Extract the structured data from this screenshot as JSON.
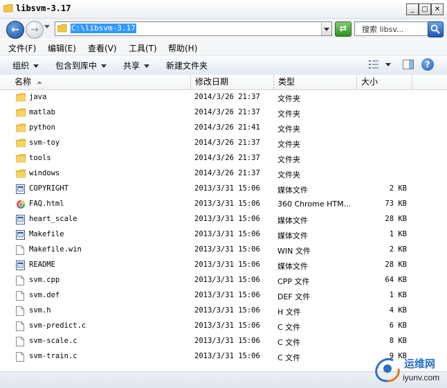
{
  "window": {
    "title": "libsvm-3.17"
  },
  "address_bar": {
    "path": "C:\\libsvm-3.17"
  },
  "search": {
    "placeholder": "搜索 libsv..."
  },
  "menu": [
    "文件(F)",
    "编辑(E)",
    "查看(V)",
    "工具(T)",
    "帮助(H)"
  ],
  "toolbar": {
    "organize": "组织",
    "include_in_library": "包含到库中",
    "share": "共享",
    "new_folder": "新建文件夹"
  },
  "columns": {
    "name": "名称",
    "date": "修改日期",
    "type": "类型",
    "size": "大小"
  },
  "files": [
    {
      "name": "java",
      "date": "2014/3/26 21:37",
      "type": "文件夹",
      "size": "",
      "icon": "folder-icon"
    },
    {
      "name": "matlab",
      "date": "2014/3/26 21:37",
      "type": "文件夹",
      "size": "",
      "icon": "folder-icon"
    },
    {
      "name": "python",
      "date": "2014/3/26 21:41",
      "type": "文件夹",
      "size": "",
      "icon": "folder-icon"
    },
    {
      "name": "svm-toy",
      "date": "2014/3/26 21:37",
      "type": "文件夹",
      "size": "",
      "icon": "folder-icon"
    },
    {
      "name": "tools",
      "date": "2014/3/26 21:37",
      "type": "文件夹",
      "size": "",
      "icon": "folder-icon"
    },
    {
      "name": "windows",
      "date": "2014/3/26 21:37",
      "type": "文件夹",
      "size": "",
      "icon": "folder-icon"
    },
    {
      "name": "COPYRIGHT",
      "date": "2013/3/31 15:06",
      "type": "媒体文件",
      "size": "2 KB",
      "icon": "media-file-icon"
    },
    {
      "name": "FAQ.html",
      "date": "2013/3/31 15:06",
      "type": "360 Chrome HTM...",
      "size": "73 KB",
      "icon": "browser-html-icon"
    },
    {
      "name": "heart_scale",
      "date": "2013/3/31 15:06",
      "type": "媒体文件",
      "size": "28 KB",
      "icon": "media-file-icon"
    },
    {
      "name": "Makefile",
      "date": "2013/3/31 15:06",
      "type": "媒体文件",
      "size": "1 KB",
      "icon": "media-file-icon"
    },
    {
      "name": "Makefile.win",
      "date": "2013/3/31 15:06",
      "type": "WIN 文件",
      "size": "2 KB",
      "icon": "blank-file-icon"
    },
    {
      "name": "README",
      "date": "2013/3/31 15:06",
      "type": "媒体文件",
      "size": "28 KB",
      "icon": "media-file-icon"
    },
    {
      "name": "svm.cpp",
      "date": "2013/3/31 15:06",
      "type": "CPP 文件",
      "size": "64 KB",
      "icon": "blank-file-icon"
    },
    {
      "name": "svm.def",
      "date": "2013/3/31 15:06",
      "type": "DEF 文件",
      "size": "1 KB",
      "icon": "blank-file-icon"
    },
    {
      "name": "svm.h",
      "date": "2013/3/31 15:06",
      "type": "H 文件",
      "size": "4 KB",
      "icon": "blank-file-icon"
    },
    {
      "name": "svm-predict.c",
      "date": "2013/3/31 15:06",
      "type": "C 文件",
      "size": "6 KB",
      "icon": "blank-file-icon"
    },
    {
      "name": "svm-scale.c",
      "date": "2013/3/31 15:06",
      "type": "C 文件",
      "size": "8 KB",
      "icon": "blank-file-icon"
    },
    {
      "name": "svm-train.c",
      "date": "2013/3/31 15:06",
      "type": "C 文件",
      "size": "9 KB",
      "icon": "blank-file-icon"
    }
  ],
  "watermark": {
    "line1": "运维网",
    "line2": "iyunv.com"
  }
}
